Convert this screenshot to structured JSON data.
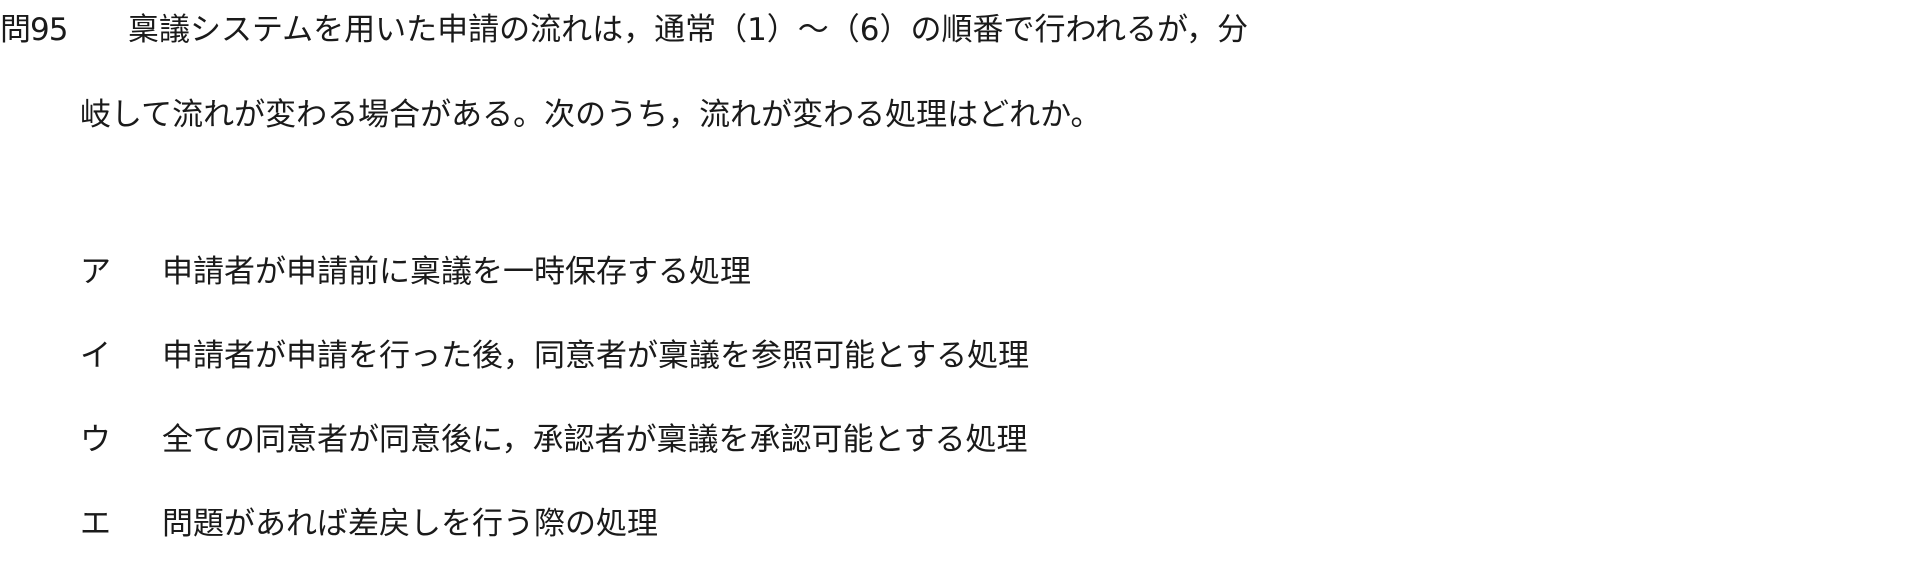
{
  "question": {
    "number": "問95",
    "line1": "稟議システムを用いた申請の流れは，通常（1）～（6）の順番で行われるが，分",
    "line2": "岐して流れが変わる場合がある。次のうち，流れが変わる処理はどれか。"
  },
  "choices": [
    {
      "mark": "ア",
      "text": "申請者が申請前に稟議を一時保存する処理"
    },
    {
      "mark": "イ",
      "text": "申請者が申請を行った後，同意者が稟議を参照可能とする処理"
    },
    {
      "mark": "ウ",
      "text": "全ての同意者が同意後に，承認者が稟議を承認可能とする処理"
    },
    {
      "mark": "エ",
      "text": "問題があれば差戻しを行う際の処理"
    }
  ]
}
